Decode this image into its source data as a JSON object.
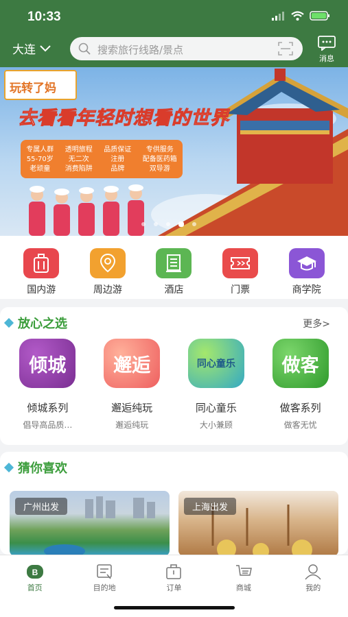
{
  "status": {
    "time": "10:33"
  },
  "header": {
    "city": "大连",
    "search_placeholder": "搜索旅行线路/景点",
    "message_label": "消息"
  },
  "banner": {
    "tag": "玩转了妈",
    "slogan": "去看看年轻时想看的世界",
    "features": [
      {
        "title": "专属人群",
        "line2": "55-70岁",
        "line3": "老顽童"
      },
      {
        "title": "透明旅程",
        "line2": "无二次",
        "line3": "消费陷阱"
      },
      {
        "title": "品质保证",
        "line2": "注册",
        "line3": "品牌"
      },
      {
        "title": "专供服务",
        "line2": "配备医药箱",
        "line3": "双导游"
      }
    ],
    "active_dot": 3
  },
  "categories": [
    {
      "label": "国内游",
      "icon": "luggage-icon",
      "color": "#e8474d"
    },
    {
      "label": "周边游",
      "icon": "map-pin-icon",
      "color": "#f2a12f"
    },
    {
      "label": "酒店",
      "icon": "hotel-icon",
      "color": "#5cb653"
    },
    {
      "label": "门票",
      "icon": "ticket-icon",
      "color": "#e94b4b"
    },
    {
      "label": "商学院",
      "icon": "graduation-cap-icon",
      "color": "#8b56d6"
    }
  ],
  "trusted": {
    "title": "放心之选",
    "more": "更多>",
    "brands": [
      {
        "logo": "倾城",
        "name": "倾城系列",
        "sub": "倡导高品质…",
        "color": "#8a3fa2"
      },
      {
        "logo": "邂逅",
        "name": "邂逅纯玩",
        "sub": "邂逅纯玩",
        "color": "#f06b62"
      },
      {
        "logo": "同心童乐",
        "name": "同心童乐",
        "sub": "大小兼顾",
        "color": "#3ab7c8"
      },
      {
        "logo": "做客",
        "name": "做客系列",
        "sub": "做客无忧",
        "color": "#47ae3a"
      }
    ]
  },
  "guess": {
    "title": "猜你喜欢",
    "items": [
      {
        "label": "广州出发"
      },
      {
        "label": "上海出发"
      }
    ]
  },
  "tabs": [
    {
      "label": "首页",
      "icon": "home-icon",
      "active": true
    },
    {
      "label": "目的地",
      "icon": "destination-icon",
      "active": false
    },
    {
      "label": "订单",
      "icon": "order-icon",
      "active": false
    },
    {
      "label": "商城",
      "icon": "mall-icon",
      "active": false
    },
    {
      "label": "我的",
      "icon": "profile-icon",
      "active": false
    }
  ],
  "colors": {
    "brand_green": "#3d7a42",
    "accent_blue": "#4db6d6"
  }
}
